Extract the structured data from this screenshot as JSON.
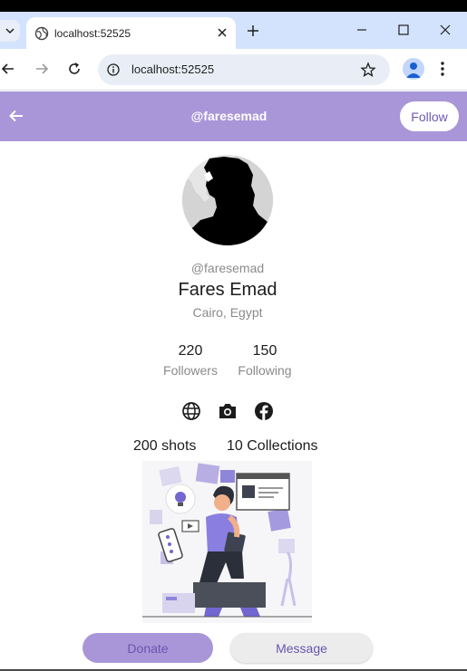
{
  "browser": {
    "tab_title": "localhost:52525",
    "url": "localhost:52525",
    "icons": [
      "globe-icon",
      "close-icon",
      "plus-icon",
      "minimize-icon",
      "maximize-icon",
      "window-close-icon",
      "back-icon",
      "forward-icon",
      "reload-icon",
      "info-icon",
      "star-icon",
      "profile-icon",
      "kebab-menu-icon"
    ]
  },
  "appbar": {
    "title": "@faresemad",
    "follow_label": "Follow",
    "color": "#a996d8"
  },
  "profile": {
    "handle": "@faresemad",
    "name": "Fares Emad",
    "location": "Cairo, Egypt"
  },
  "stats": {
    "followers_count": "220",
    "followers_label": "Followers",
    "following_count": "150",
    "following_label": "Following"
  },
  "social": [
    "globe-icon",
    "camera-icon",
    "facebook-icon"
  ],
  "counts": {
    "shots": "200 shots",
    "collections": "10 Collections"
  },
  "actions": {
    "donate_label": "Donate",
    "message_label": "Message"
  },
  "colors": {
    "accent": "#a996d8",
    "accent_text": "#6a55ad",
    "tabstrip": "#d3e3fd"
  }
}
